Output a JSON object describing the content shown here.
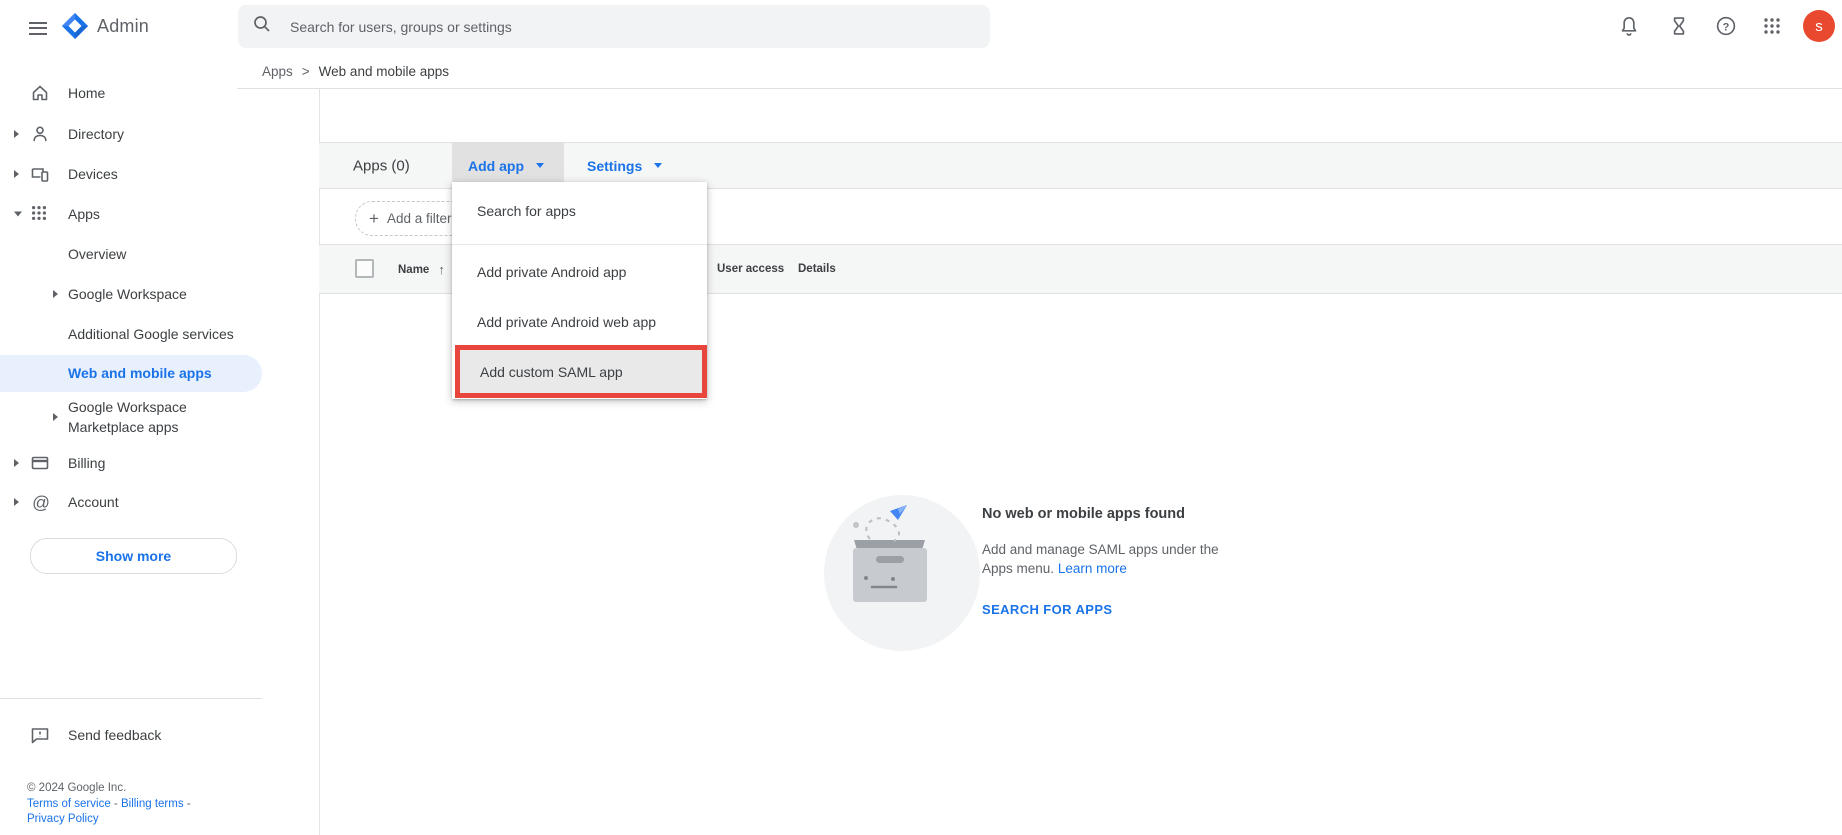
{
  "topbar": {
    "product": "Admin",
    "search_placeholder": "Search for users, groups or settings",
    "avatar_initial": "s"
  },
  "breadcrumb": {
    "parent": "Apps",
    "separator": ">",
    "current": "Web and mobile apps"
  },
  "sidebar": {
    "home": "Home",
    "directory": "Directory",
    "devices": "Devices",
    "apps": "Apps",
    "overview": "Overview",
    "google_workspace": "Google Workspace",
    "additional_services": "Additional Google services",
    "web_mobile": "Web and mobile apps",
    "marketplace": "Google Workspace Marketplace apps",
    "billing": "Billing",
    "account": "Account",
    "show_more": "Show more",
    "send_feedback": "Send feedback",
    "copyright": "© 2024 Google Inc.",
    "terms": "Terms of service",
    "billing_terms": "Billing terms",
    "privacy": "Privacy Policy",
    "link_sep": "-"
  },
  "toolbar": {
    "title": "Apps (0)",
    "add_app": "Add app",
    "settings": "Settings"
  },
  "filter": {
    "add_filter": "Add a filter"
  },
  "add_app_menu": {
    "search_for_apps": "Search for apps",
    "private_android": "Add private Android app",
    "private_android_web": "Add private Android web app",
    "custom_saml": "Add custom SAML app"
  },
  "table": {
    "name": "Name",
    "sort_arrow": "↑",
    "user_access": "User access",
    "details": "Details"
  },
  "empty_state": {
    "title": "No web or mobile apps found",
    "description": "Add and manage SAML apps under the Apps menu.",
    "learn_more": "Learn more",
    "action": "SEARCH FOR APPS"
  },
  "colors": {
    "accent": "#1a73e8",
    "selected_bg": "#e8f0fe",
    "annotation_red": "#e8453c",
    "avatar_bg": "#e8492f"
  }
}
